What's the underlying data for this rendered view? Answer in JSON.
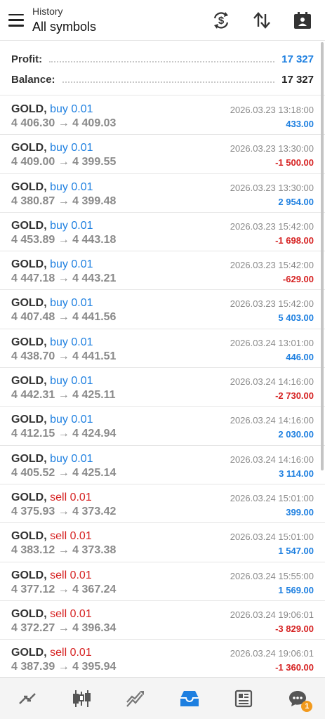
{
  "header": {
    "subtitle": "History",
    "title": "All symbols",
    "icons": [
      "menu-icon",
      "dollar-refresh-icon",
      "sort-icon",
      "calendar-icon"
    ]
  },
  "summary": {
    "profit_label": "Profit:",
    "profit_value": "17 327",
    "balance_label": "Balance:",
    "balance_value": "17 327",
    "colors": {
      "positive": "#1d7fe0",
      "negative": "#d62222",
      "buy": "#1d7fe0",
      "sell": "#d62222"
    }
  },
  "trades": [
    {
      "symbol": "GOLD,",
      "side": "buy 0.01",
      "type": "buy",
      "prices": "4 406.30 → 4 409.03",
      "time": "2026.03.23 13:18:00",
      "profit": "433.00",
      "sign": "pos"
    },
    {
      "symbol": "GOLD,",
      "side": "buy 0.01",
      "type": "buy",
      "prices": "4 409.00 → 4 399.55",
      "time": "2026.03.23 13:30:00",
      "profit": "-1 500.00",
      "sign": "neg"
    },
    {
      "symbol": "GOLD,",
      "side": "buy 0.01",
      "type": "buy",
      "prices": "4 380.87 → 4 399.48",
      "time": "2026.03.23 13:30:00",
      "profit": "2 954.00",
      "sign": "pos"
    },
    {
      "symbol": "GOLD,",
      "side": "buy 0.01",
      "type": "buy",
      "prices": "4 453.89 → 4 443.18",
      "time": "2026.03.23 15:42:00",
      "profit": "-1 698.00",
      "sign": "neg"
    },
    {
      "symbol": "GOLD,",
      "side": "buy 0.01",
      "type": "buy",
      "prices": "4 447.18 → 4 443.21",
      "time": "2026.03.23 15:42:00",
      "profit": "-629.00",
      "sign": "neg"
    },
    {
      "symbol": "GOLD,",
      "side": "buy 0.01",
      "type": "buy",
      "prices": "4 407.48 → 4 441.56",
      "time": "2026.03.23 15:42:00",
      "profit": "5 403.00",
      "sign": "pos"
    },
    {
      "symbol": "GOLD,",
      "side": "buy 0.01",
      "type": "buy",
      "prices": "4 438.70 → 4 441.51",
      "time": "2026.03.24 13:01:00",
      "profit": "446.00",
      "sign": "pos"
    },
    {
      "symbol": "GOLD,",
      "side": "buy 0.01",
      "type": "buy",
      "prices": "4 442.31 → 4 425.11",
      "time": "2026.03.24 14:16:00",
      "profit": "-2 730.00",
      "sign": "neg"
    },
    {
      "symbol": "GOLD,",
      "side": "buy 0.01",
      "type": "buy",
      "prices": "4 412.15 → 4 424.94",
      "time": "2026.03.24 14:16:00",
      "profit": "2 030.00",
      "sign": "pos"
    },
    {
      "symbol": "GOLD,",
      "side": "buy 0.01",
      "type": "buy",
      "prices": "4 405.52 → 4 425.14",
      "time": "2026.03.24 14:16:00",
      "profit": "3 114.00",
      "sign": "pos"
    },
    {
      "symbol": "GOLD,",
      "side": "sell 0.01",
      "type": "sell",
      "prices": "4 375.93 → 4 373.42",
      "time": "2026.03.24 15:01:00",
      "profit": "399.00",
      "sign": "pos"
    },
    {
      "symbol": "GOLD,",
      "side": "sell 0.01",
      "type": "sell",
      "prices": "4 383.12 → 4 373.38",
      "time": "2026.03.24 15:01:00",
      "profit": "1 547.00",
      "sign": "pos"
    },
    {
      "symbol": "GOLD,",
      "side": "sell 0.01",
      "type": "sell",
      "prices": "4 377.12 → 4 367.24",
      "time": "2026.03.24 15:55:00",
      "profit": "1 569.00",
      "sign": "pos"
    },
    {
      "symbol": "GOLD,",
      "side": "sell 0.01",
      "type": "sell",
      "prices": "4 372.27 → 4 396.34",
      "time": "2026.03.24 19:06:01",
      "profit": "-3 829.00",
      "sign": "neg"
    },
    {
      "symbol": "GOLD,",
      "side": "sell 0.01",
      "type": "sell",
      "prices": "4 387.39 → 4 395.94",
      "time": "2026.03.24 19:06:01",
      "profit": "-1 360.00",
      "sign": "neg"
    }
  ],
  "bottom_nav": {
    "items": [
      "quotes-icon",
      "chart-icon",
      "trade-icon",
      "history-icon",
      "news-icon",
      "chat-icon"
    ],
    "active": "history-icon",
    "chat_badge": "1"
  }
}
